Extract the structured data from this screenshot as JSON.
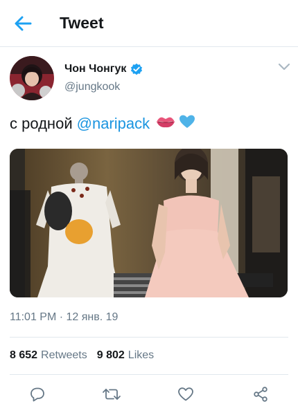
{
  "header": {
    "title": "Tweet",
    "back_icon": "arrow-left-icon"
  },
  "colors": {
    "accent": "#1da1f2",
    "text": "#14171a",
    "secondary": "#657786",
    "divider": "#e1e8ed"
  },
  "tweet": {
    "author": {
      "name": "Чон Чонгук",
      "handle": "@jungkook",
      "verified": true
    },
    "text_prefix": "с родной",
    "mention": "@naripack",
    "emojis": [
      "kiss-mark-icon",
      "blue-heart-icon"
    ],
    "timestamp": "11:01 PM · 12 янв. 19",
    "stats": {
      "retweets_count": "8 652",
      "retweets_label": "Retweets",
      "likes_count": "9 802",
      "likes_label": "Likes"
    }
  },
  "actions": [
    "reply-icon",
    "retweet-icon",
    "like-icon",
    "share-icon"
  ]
}
